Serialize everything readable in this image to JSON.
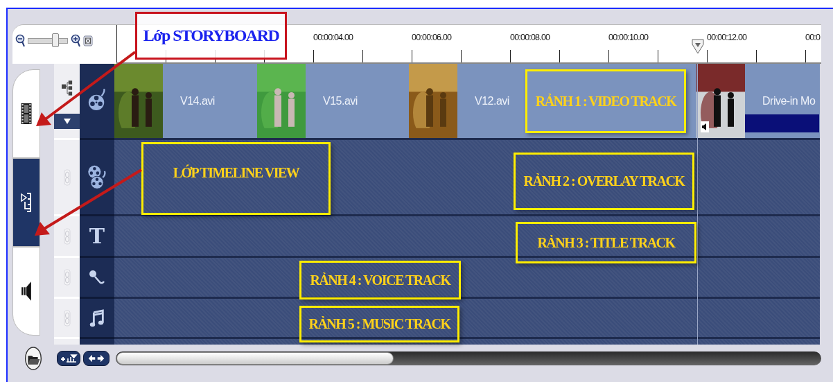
{
  "zoom_control": {
    "level": 0.7
  },
  "ruler": {
    "labels": [
      "00:00:04.00",
      "00:00:06.00",
      "00:00:08.00",
      "00:00:10.00",
      "00:00:12.00",
      "00:0"
    ]
  },
  "view_tabs": [
    {
      "kind": "storyboard",
      "selected": false
    },
    {
      "kind": "timeline",
      "selected": true
    },
    {
      "kind": "audio",
      "selected": false
    }
  ],
  "tracks": [
    {
      "kind": "video",
      "clips": [
        {
          "name": "V14.avi",
          "audio": false
        },
        {
          "name": "V15.avi",
          "audio": false
        },
        {
          "name": "V12.avi",
          "audio": false
        },
        {
          "name": "Drive-in Mo",
          "audio": true
        }
      ]
    },
    {
      "kind": "overlay"
    },
    {
      "kind": "title",
      "glyph": "T"
    },
    {
      "kind": "voice"
    },
    {
      "kind": "music"
    }
  ],
  "annotations": [
    {
      "kind": "header",
      "text": "Lớp STORYBOARD",
      "arrow": true
    },
    {
      "kind": "note",
      "text": "RẢNH 1 : VIDEO TRACK",
      "arrow": false
    },
    {
      "kind": "note",
      "text": "LỚP TIMELINE VIEW",
      "arrow": true
    },
    {
      "kind": "note",
      "text": "RẢNH 2 : OVERLAY TRACK",
      "arrow": false
    },
    {
      "kind": "note",
      "text": "RẢNH 3 : TITLE TRACK",
      "arrow": false
    },
    {
      "kind": "note",
      "text": "RẢNH 4 : VOICE TRACK",
      "arrow": false
    },
    {
      "kind": "note",
      "text": "RẢNH 5 : MUSIC TRACK",
      "arrow": false
    }
  ]
}
